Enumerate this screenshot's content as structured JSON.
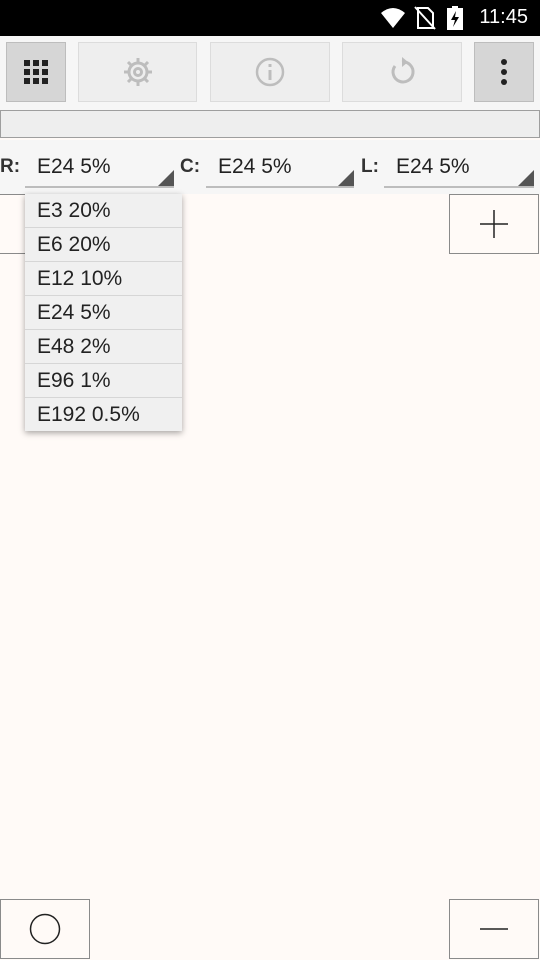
{
  "status_bar": {
    "time": "11:45",
    "icons": [
      "wifi-icon",
      "no-sim-icon",
      "battery-charging-icon"
    ]
  },
  "toolbar": {
    "buttons": [
      {
        "icon": "grid-icon"
      },
      {
        "icon": "settings-icon"
      },
      {
        "icon": "info-icon"
      },
      {
        "icon": "refresh-icon"
      },
      {
        "icon": "more-vert-icon"
      }
    ]
  },
  "selectors": {
    "r": {
      "label": "R:",
      "value": "E24 5%"
    },
    "c": {
      "label": "C:",
      "value": "E24 5%"
    },
    "l": {
      "label": "L:",
      "value": "E24 5%"
    }
  },
  "dropdown": {
    "items": [
      "E3 20%",
      "E6 20%",
      "E12 10%",
      "E24 5%",
      "E48 2%",
      "E96 1%",
      "E192 0.5%"
    ]
  },
  "corner_buttons": [
    "add-icon",
    "circle-icon",
    "remove-icon"
  ]
}
